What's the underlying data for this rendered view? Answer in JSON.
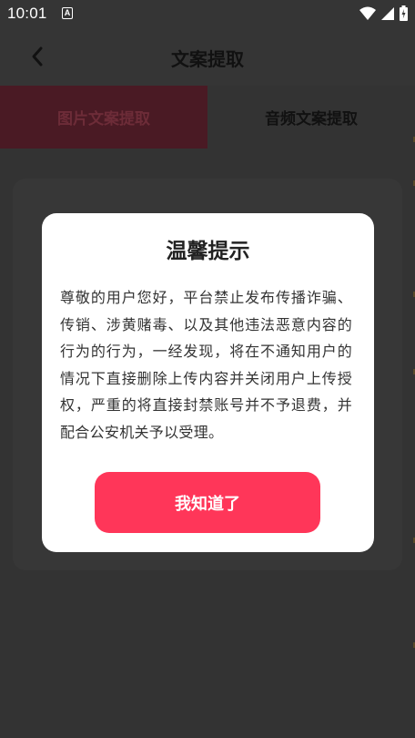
{
  "status_bar": {
    "time": "10:01",
    "notification_icon": "a-notification-icon",
    "icons": [
      "wifi-icon",
      "signal-icon",
      "battery-icon"
    ]
  },
  "header": {
    "title": "文案提取",
    "back_icon": "chevron-left-icon"
  },
  "tabs": [
    {
      "label": "图片文案提取",
      "selected": true
    },
    {
      "label": "音频文案提取",
      "selected": false
    }
  ],
  "dialog": {
    "title": "温馨提示",
    "body": "尊敬的用户您好，平台禁止发布传播诈骗、传销、涉黄赌毒、以及其他违法恶意内容的行为的行为，一经发现，将在不通知用户的情况下直接删除上传内容并关闭用户上传授权，严重的将直接封禁账号并不予退费，并配合公安机关予以受理。",
    "button_label": "我知道了"
  },
  "colors": {
    "accent": "#ff3659",
    "overlay_background": "#333333",
    "dialog_background": "#ffffff",
    "selected_tab_background": "#4a1a24"
  }
}
